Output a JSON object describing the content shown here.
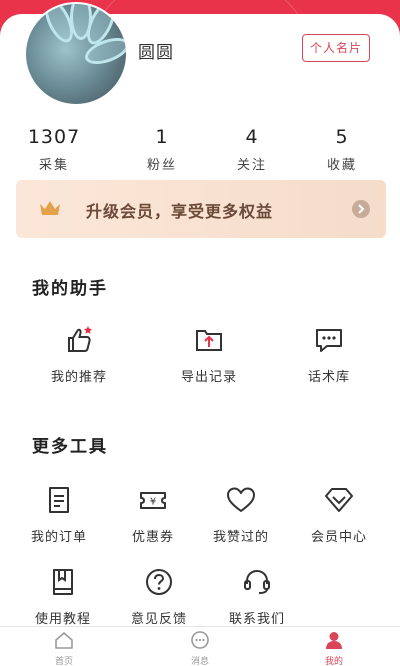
{
  "profile": {
    "username": "圆圆",
    "card_button": "个人名片"
  },
  "stats": [
    {
      "value": "1307",
      "label": "采集"
    },
    {
      "value": "1",
      "label": "粉丝"
    },
    {
      "value": "4",
      "label": "关注"
    },
    {
      "value": "5",
      "label": "收藏"
    }
  ],
  "vip_banner": {
    "text": "升级会员，享受更多权益",
    "crown_icon": "crown-icon",
    "arrow_icon": "chevron-right-icon"
  },
  "assistant": {
    "title": "我的助手",
    "items": [
      {
        "label": "我的推荐",
        "icon": "thumbs-up-icon"
      },
      {
        "label": "导出记录",
        "icon": "export-folder-icon"
      },
      {
        "label": "话术库",
        "icon": "chat-bubble-icon"
      }
    ]
  },
  "tools": {
    "title": "更多工具",
    "items": [
      {
        "label": "我的订单",
        "icon": "order-icon"
      },
      {
        "label": "优惠券",
        "icon": "coupon-icon"
      },
      {
        "label": "我赞过的",
        "icon": "heart-icon"
      },
      {
        "label": "会员中心",
        "icon": "diamond-icon"
      },
      {
        "label": "使用教程",
        "icon": "book-icon"
      },
      {
        "label": "意见反馈",
        "icon": "question-icon"
      },
      {
        "label": "联系我们",
        "icon": "headset-icon"
      }
    ]
  },
  "tabbar": {
    "items": [
      {
        "label": "首页",
        "icon": "home-icon",
        "active": false
      },
      {
        "label": "消息",
        "icon": "message-icon",
        "active": false
      },
      {
        "label": "我的",
        "icon": "user-icon",
        "active": true
      }
    ]
  },
  "colors": {
    "brand": "#e8334a",
    "accent": "#d9465a",
    "vip_text": "#6b4a38"
  }
}
